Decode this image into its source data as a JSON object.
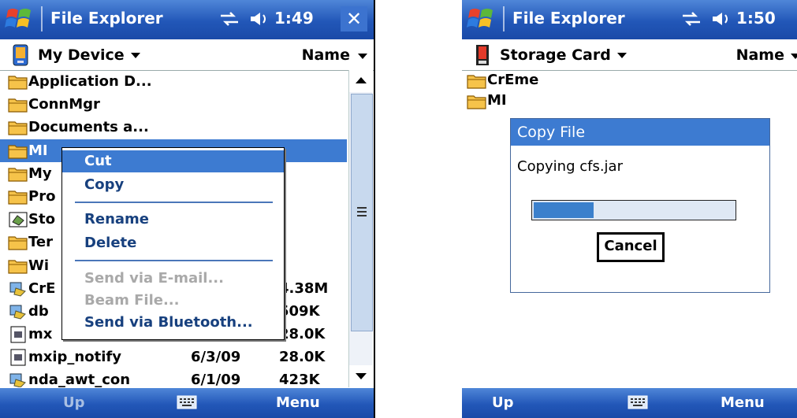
{
  "screen1": {
    "title": "File Explorer",
    "time": "1:49",
    "close_label": "✕",
    "location": "My Device",
    "sort_label": "Name",
    "files": [
      {
        "name": "Application D...",
        "date": "",
        "size": "",
        "icon": "folder-icon"
      },
      {
        "name": "ConnMgr",
        "date": "",
        "size": "",
        "icon": "folder-icon"
      },
      {
        "name": "Documents a...",
        "date": "",
        "size": "",
        "icon": "folder-icon"
      },
      {
        "name": "MI",
        "date": "",
        "size": "",
        "icon": "folder-icon",
        "selected": true
      },
      {
        "name": "My",
        "date": "",
        "size": "",
        "icon": "folder-icon"
      },
      {
        "name": "Pro",
        "date": "",
        "size": "",
        "icon": "folder-icon"
      },
      {
        "name": "Sto",
        "date": "",
        "size": "",
        "icon": "storage-card-icon"
      },
      {
        "name": "Ter",
        "date": "",
        "size": "",
        "icon": "folder-icon"
      },
      {
        "name": "Wi",
        "date": "",
        "size": "",
        "icon": "folder-icon"
      },
      {
        "name": "CrE",
        "date": "",
        "size": "4.38M",
        "icon": "program-icon"
      },
      {
        "name": "db",
        "date": "",
        "size": "509K",
        "icon": "program-icon"
      },
      {
        "name": "mx",
        "date": "",
        "size": "28.0K",
        "icon": "file-icon"
      },
      {
        "name": "mxip_notify",
        "date": "6/3/09",
        "size": "28.0K",
        "icon": "file-icon"
      },
      {
        "name": "nda_awt_con",
        "date": "6/1/09",
        "size": "423K",
        "icon": "program-icon"
      }
    ],
    "context_menu": {
      "items": [
        {
          "label": "Cut",
          "state": "highlighted"
        },
        {
          "label": "Copy",
          "state": "normal"
        },
        {
          "label": "Rename",
          "state": "normal"
        },
        {
          "label": "Delete",
          "state": "normal"
        },
        {
          "label": "Send via E-mail...",
          "state": "disabled"
        },
        {
          "label": "Beam File...",
          "state": "disabled"
        },
        {
          "label": "Send via Bluetooth...",
          "state": "normal"
        }
      ]
    },
    "menubar": {
      "left": "Up",
      "right": "Menu"
    }
  },
  "screen2": {
    "title": "File Explorer",
    "time": "1:50",
    "location": "Storage Card",
    "sort_label": "Name",
    "files": [
      {
        "name": "CrEme",
        "icon": "folder-icon"
      },
      {
        "name": "MI",
        "icon": "folder-icon"
      }
    ],
    "dialog": {
      "title": "Copy File",
      "message": "Copying cfs.jar",
      "progress": 0.3,
      "cancel_label": "Cancel"
    },
    "menubar": {
      "left": "Up",
      "right": "Menu"
    }
  },
  "colors": {
    "titlebar": "#2257b8",
    "selection": "#3d7bd1",
    "menu_text": "#17407e",
    "disabled_text": "#a9a9a9"
  }
}
